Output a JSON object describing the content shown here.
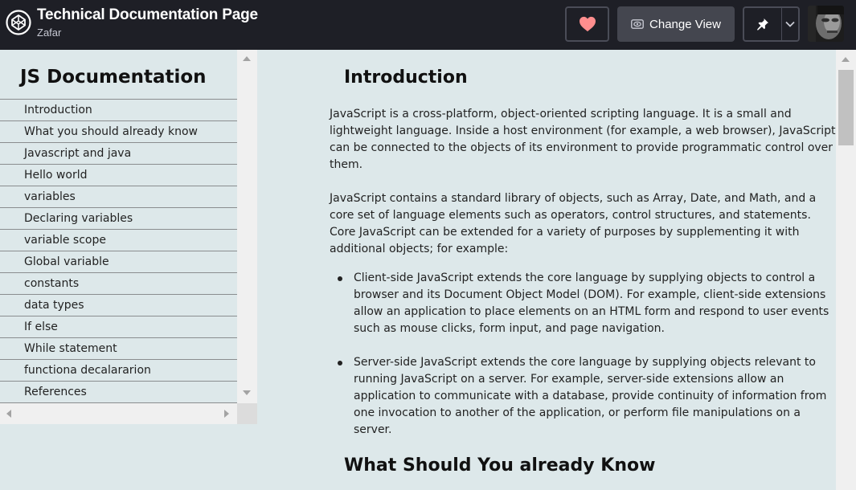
{
  "header": {
    "title": "Technical Documentation Page",
    "author": "Zafar",
    "change_view_label": "Change View",
    "icons": [
      "codepen-logo-icon",
      "heart-icon",
      "eye-icon",
      "pin-icon",
      "chevron-down-icon"
    ],
    "colors": {
      "background": "#1e1f26",
      "heart": "#ff8e8e",
      "button": "#44464f"
    }
  },
  "sidebar": {
    "title": "JS Documentation",
    "items": [
      "Introduction",
      "What you should already know",
      "Javascript and java",
      "Hello world",
      "variables",
      "Declaring variables",
      "variable scope",
      "Global variable",
      "constants",
      "data types",
      "If else",
      "While statement",
      "functiona decalararion",
      "References"
    ]
  },
  "main": {
    "intro_title": "Introduction",
    "intro_p1": "JavaScript is a cross-platform, object-oriented scripting language. It is a small and lightweight language. Inside a host environment (for example, a web browser), JavaScript can be connected to the objects of its environment to provide programmatic control over them.",
    "intro_p2": "JavaScript contains a standard library of objects, such as Array, Date, and Math, and a core set of language elements such as operators, control structures, and statements. Core JavaScript can be extended for a variety of purposes by supplementing it with additional objects; for example:",
    "bullets": [
      "Client-side JavaScript extends the core language by supplying objects to control a browser and its Document Object Model (DOM). For example, client-side extensions allow an application to place elements on an HTML form and respond to user events such as mouse clicks, form input, and page navigation.",
      "Server-side JavaScript extends the core language by supplying objects relevant to running JavaScript on a server. For example, server-side extensions allow an application to communicate with a database, provide continuity of information from one invocation to another of the application, or perform file manipulations on a server."
    ],
    "second_title": "What Should You already Know"
  }
}
